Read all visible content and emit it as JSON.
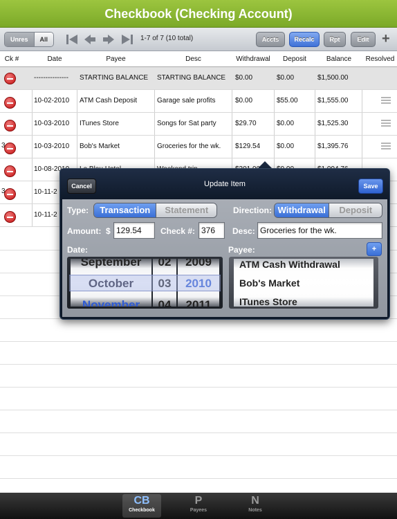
{
  "app_title": "Checkbook (Checking Account)",
  "toolbar": {
    "filter_unresolved": "Unres",
    "filter_all": "All",
    "count_text": "1-7 of 7 (10 total)",
    "accts": "Accts",
    "recalc": "Recalc",
    "rpt": "Rpt",
    "edit": "Edit",
    "add": "+"
  },
  "columns": [
    "Ck #",
    "Date",
    "Payee",
    "Desc",
    "Withdrawal",
    "Deposit",
    "Balance",
    "Resolved"
  ],
  "rows": [
    {
      "check": "",
      "date": "---------------",
      "payee": "STARTING BALANCE",
      "desc": "STARTING BALANCE",
      "withdrawal": "$0.00",
      "deposit": "$0.00",
      "balance": "$1,500.00"
    },
    {
      "check": "",
      "date": "10-02-2010",
      "payee": "ATM Cash Deposit",
      "desc": "Garage sale profits",
      "withdrawal": "$0.00",
      "deposit": "$55.00",
      "balance": "$1,555.00"
    },
    {
      "check": "",
      "date": "10-03-2010",
      "payee": "ITunes Store",
      "desc": "Songs for Sat party",
      "withdrawal": "$29.70",
      "deposit": "$0.00",
      "balance": "$1,525.30"
    },
    {
      "check": "3",
      "date": "10-03-2010",
      "payee": "Bob's Market",
      "desc": "Groceries for the wk.",
      "withdrawal": "$129.54",
      "deposit": "$0.00",
      "balance": "$1,395.76"
    },
    {
      "check": "",
      "date": "10-08-2010",
      "payee": "Le Bleu Hotel",
      "desc": "Weekend trip",
      "withdrawal": "$301.00",
      "deposit": "$0.00",
      "balance": "$1,094.76"
    },
    {
      "check": "3",
      "date": "10-11-2",
      "payee": "",
      "desc": "",
      "withdrawal": "",
      "deposit": "",
      "balance": ""
    },
    {
      "check": "",
      "date": "10-11-2",
      "payee": "",
      "desc": "",
      "withdrawal": "",
      "deposit": "",
      "balance": ""
    }
  ],
  "popover": {
    "title": "Update Item",
    "cancel": "Cancel",
    "save": "Save",
    "type_label": "Type:",
    "type_options": [
      "Transaction",
      "Statement"
    ],
    "direction_label": "Direction:",
    "direction_options": [
      "Withdrawal",
      "Deposit"
    ],
    "amount_label": "Amount:",
    "currency": "$",
    "amount_value": "129.54",
    "check_label": "Check #:",
    "check_value": "376",
    "desc_label": "Desc:",
    "desc_value": "Groceries for the wk.",
    "date_label": "Date:",
    "payee_label": "Payee:",
    "add_payee": "+",
    "date_picker": {
      "months": [
        "September",
        "October",
        "November"
      ],
      "days": [
        "02",
        "03",
        "04"
      ],
      "years": [
        "2009",
        "2010",
        "2011"
      ]
    },
    "payee_list": [
      "ATM Cash Withdrawal",
      "Bob's Market",
      "ITunes Store"
    ]
  },
  "tabs": [
    {
      "glyph": "CB",
      "label": "Checkbook"
    },
    {
      "glyph": "P",
      "label": "Payees"
    },
    {
      "glyph": "N",
      "label": "Notes"
    }
  ]
}
